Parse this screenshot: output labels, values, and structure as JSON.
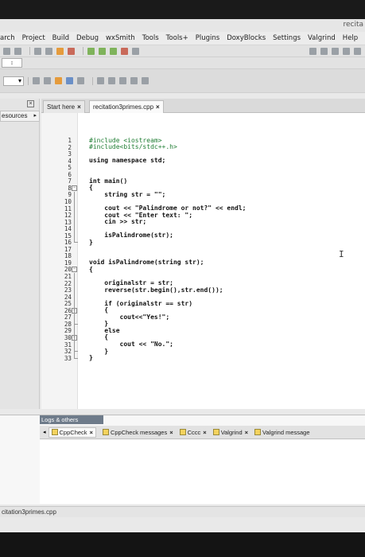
{
  "window": {
    "title": "recita"
  },
  "menu": [
    "arch",
    "Project",
    "Build",
    "Debug",
    "wxSmith",
    "Tools",
    "Tools+",
    "Plugins",
    "DoxyBlocks",
    "Settings",
    "Valgrind",
    "Help"
  ],
  "toolbar": {
    "search_value": "↕"
  },
  "management": {
    "tab_label": "esources",
    "tab_arrow": "▸",
    "close_glyph": "×"
  },
  "editor": {
    "tabs": [
      {
        "label": "Start here",
        "close": "×"
      },
      {
        "label": "recitation3primes.cpp",
        "close": "×"
      }
    ],
    "cursor_glyph": "I",
    "lines": [
      "#include <iostream>",
      "#include<bits/stdc++.h>",
      "",
      "using namespace std;",
      "",
      "",
      "int main()",
      "{",
      "    string str = \"\";",
      "",
      "    cout << \"Palindrome or not?\" << endl;",
      "    cout << \"Enter text: \";",
      "    cin >> str;",
      "",
      "    isPalindrome(str);",
      "}",
      "",
      "",
      "void isPalindrome(string str);",
      "{",
      "",
      "    originalstr = str;",
      "    reverse(str.begin(),str.end());",
      "",
      "    if (originalstr == str)",
      "    {",
      "        cout<<\"Yes!\";",
      "    }",
      "    else",
      "    {",
      "        cout << \"No.\";",
      "    }",
      "}"
    ],
    "line_numbers": [
      "1",
      "2",
      "3",
      "4",
      "5",
      "6",
      "7",
      "8",
      "9",
      "10",
      "11",
      "12",
      "13",
      "14",
      "15",
      "16",
      "17",
      "18",
      "19",
      "20",
      "21",
      "22",
      "23",
      "24",
      "25",
      "26",
      "27",
      "28",
      "29",
      "30",
      "31",
      "32",
      "33"
    ]
  },
  "logs": {
    "title": "Logs & others",
    "arrow": "◂",
    "tabs": [
      {
        "label": "CppCheck",
        "close": "×"
      },
      {
        "label": "CppCheck messages",
        "close": "×"
      },
      {
        "label": "Cccc",
        "close": "×"
      },
      {
        "label": "Valgrind",
        "close": "×"
      },
      {
        "label": "Valgrind message",
        "close": ""
      }
    ]
  },
  "status": {
    "file": "citation3primes.cpp"
  }
}
